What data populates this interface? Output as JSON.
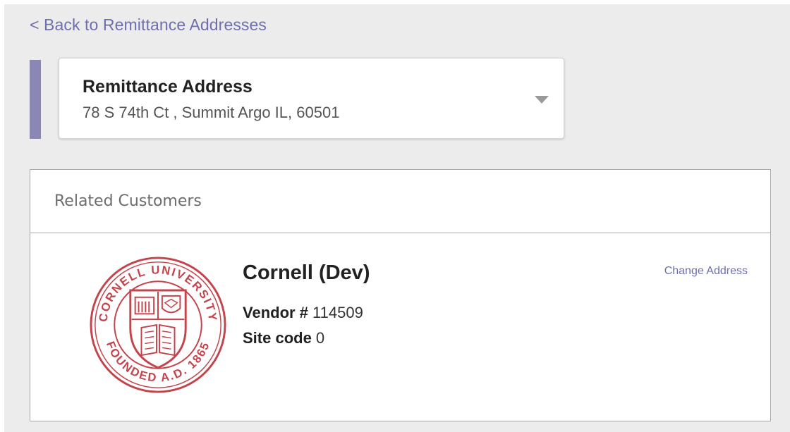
{
  "back_link": {
    "label": "< Back to Remittance Addresses"
  },
  "address_card": {
    "title": "Remittance Address",
    "address": "78 S 74th Ct , Summit Argo IL, 60501"
  },
  "related_customers": {
    "title": "Related Customers",
    "customers": [
      {
        "name": "Cornell (Dev)",
        "vendor_label": "Vendor #",
        "vendor_number": "114509",
        "site_code_label": "Site code",
        "site_code": "0",
        "action_label": "Change Address",
        "logo": {
          "icon": "cornell-university-seal",
          "top_text": "CORNELL UNIVERSITY",
          "bottom_text": "FOUNDED A.D. 1865",
          "color": "#c4444c"
        }
      }
    ]
  },
  "colors": {
    "accent": "#8a87b5",
    "link": "#6e6fae",
    "page_background": "#ececec"
  }
}
